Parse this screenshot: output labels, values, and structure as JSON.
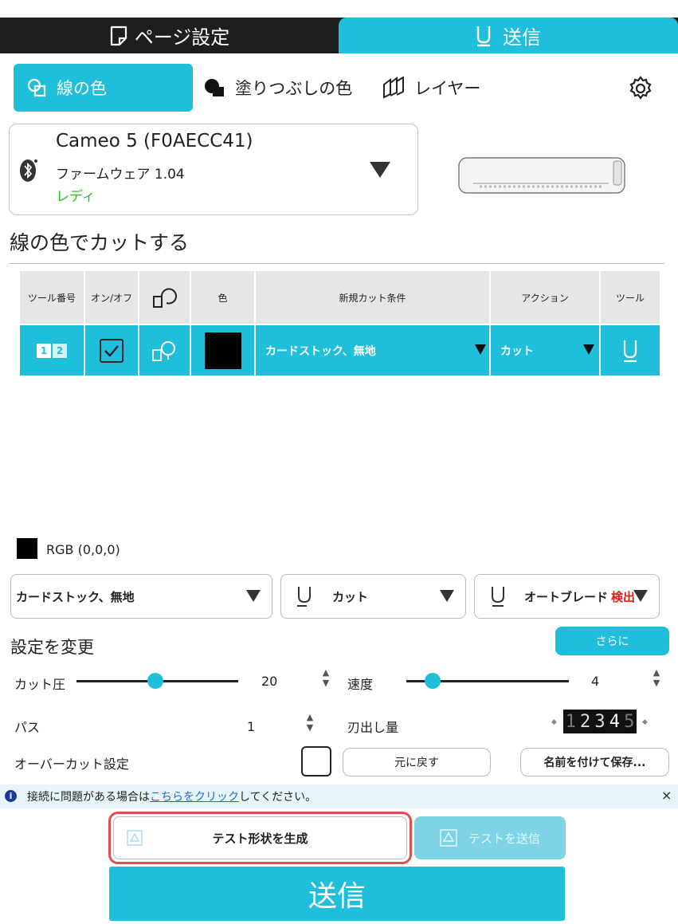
{
  "top_tabs": {
    "page_settings": "ページ設定",
    "send": "送信"
  },
  "sub_tabs": {
    "line_color": "線の色",
    "fill_color": "塗りつぶしの色",
    "layer": "レイヤー"
  },
  "device": {
    "name": "Cameo 5 (F0AECC41)",
    "firmware": "ファームウェア 1.04",
    "status": "レディ"
  },
  "section_title": "線の色でカットする",
  "table": {
    "headers": [
      "ツール番号",
      "オン/オフ",
      "",
      "色",
      "新規カット条件",
      "アクション",
      "ツール"
    ],
    "row": {
      "tool_numbers": [
        "1",
        "2"
      ],
      "checked": true,
      "color": "#000000",
      "material": "カードストック、無地",
      "action": "カット"
    }
  },
  "rgb_label": "RGB (0,0,0)",
  "dropdowns": {
    "material": "カードストック、無地",
    "action": "カット",
    "blade": "オートブレード",
    "blade_status": "検出"
  },
  "change_settings": "設定を変更",
  "more_button": "さらに",
  "settings": {
    "force_label": "カット圧",
    "force_value": "20",
    "speed_label": "速度",
    "speed_value": "4",
    "passes_label": "パス",
    "passes_value": "1",
    "blade_depth_label": "刃出し量",
    "blade_depth_digits": [
      "1",
      "2",
      "3",
      "4",
      "5"
    ],
    "overcut_label": "オーバーカット設定"
  },
  "buttons": {
    "revert": "元に戻す",
    "save_as": "名前を付けて保存..."
  },
  "info_bar": {
    "prefix": "接続に問題がある場合は",
    "link": "こちらをクリック",
    "suffix": "してください。",
    "close": "×"
  },
  "test_generate": "テスト形状を生成",
  "test_send": "テストを送信",
  "send_button": "送信",
  "colors": {
    "accent": "#1fbfdb",
    "dark_bar": "#1e1e1e",
    "ready_green": "#22c31c",
    "detected_red": "#e0201a",
    "highlight_outline": "#d9534f"
  }
}
